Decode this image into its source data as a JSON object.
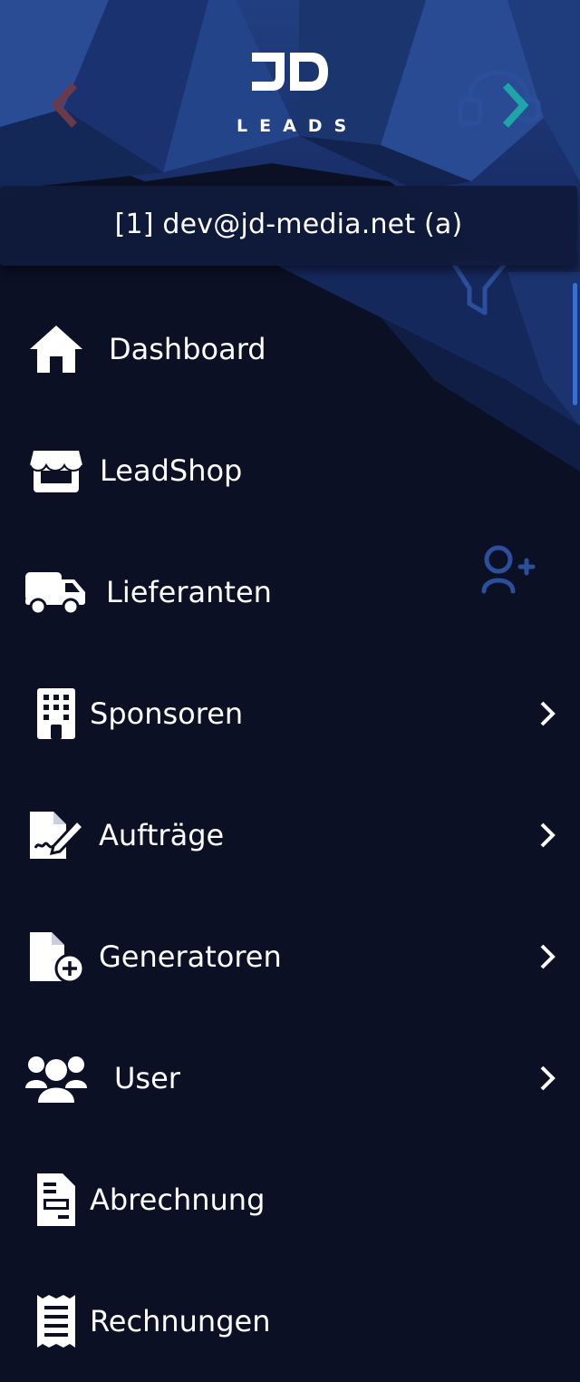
{
  "brand": {
    "logo_mark": "JD",
    "logo_text": "LEADS"
  },
  "header": {
    "prev_icon": "chevron-left-icon",
    "next_icon": "chevron-right-icon"
  },
  "account": {
    "label": "[1] dev@jd-media.net (a)"
  },
  "menu": {
    "items": [
      {
        "label": "Dashboard",
        "icon": "home-icon",
        "has_submenu": false
      },
      {
        "label": "LeadShop",
        "icon": "store-icon",
        "has_submenu": false
      },
      {
        "label": "Lieferanten",
        "icon": "truck-icon",
        "has_submenu": false
      },
      {
        "label": "Sponsoren",
        "icon": "building-icon",
        "has_submenu": true
      },
      {
        "label": "Aufträge",
        "icon": "file-signature-icon",
        "has_submenu": true
      },
      {
        "label": "Generatoren",
        "icon": "file-plus-icon",
        "has_submenu": true
      },
      {
        "label": "User",
        "icon": "users-icon",
        "has_submenu": true
      },
      {
        "label": "Abrechnung",
        "icon": "billing-icon",
        "has_submenu": false
      },
      {
        "label": "Rechnungen",
        "icon": "receipt-icon",
        "has_submenu": false
      }
    ]
  },
  "colors": {
    "background": "#0b1025",
    "header_blue": "#1c3a78",
    "account_bar": "#101a3a",
    "text": "#ffffff",
    "accent_teal": "#1fa5a8",
    "accent_red": "#6b3a4a",
    "scrollbar": "#3a6fd0"
  }
}
